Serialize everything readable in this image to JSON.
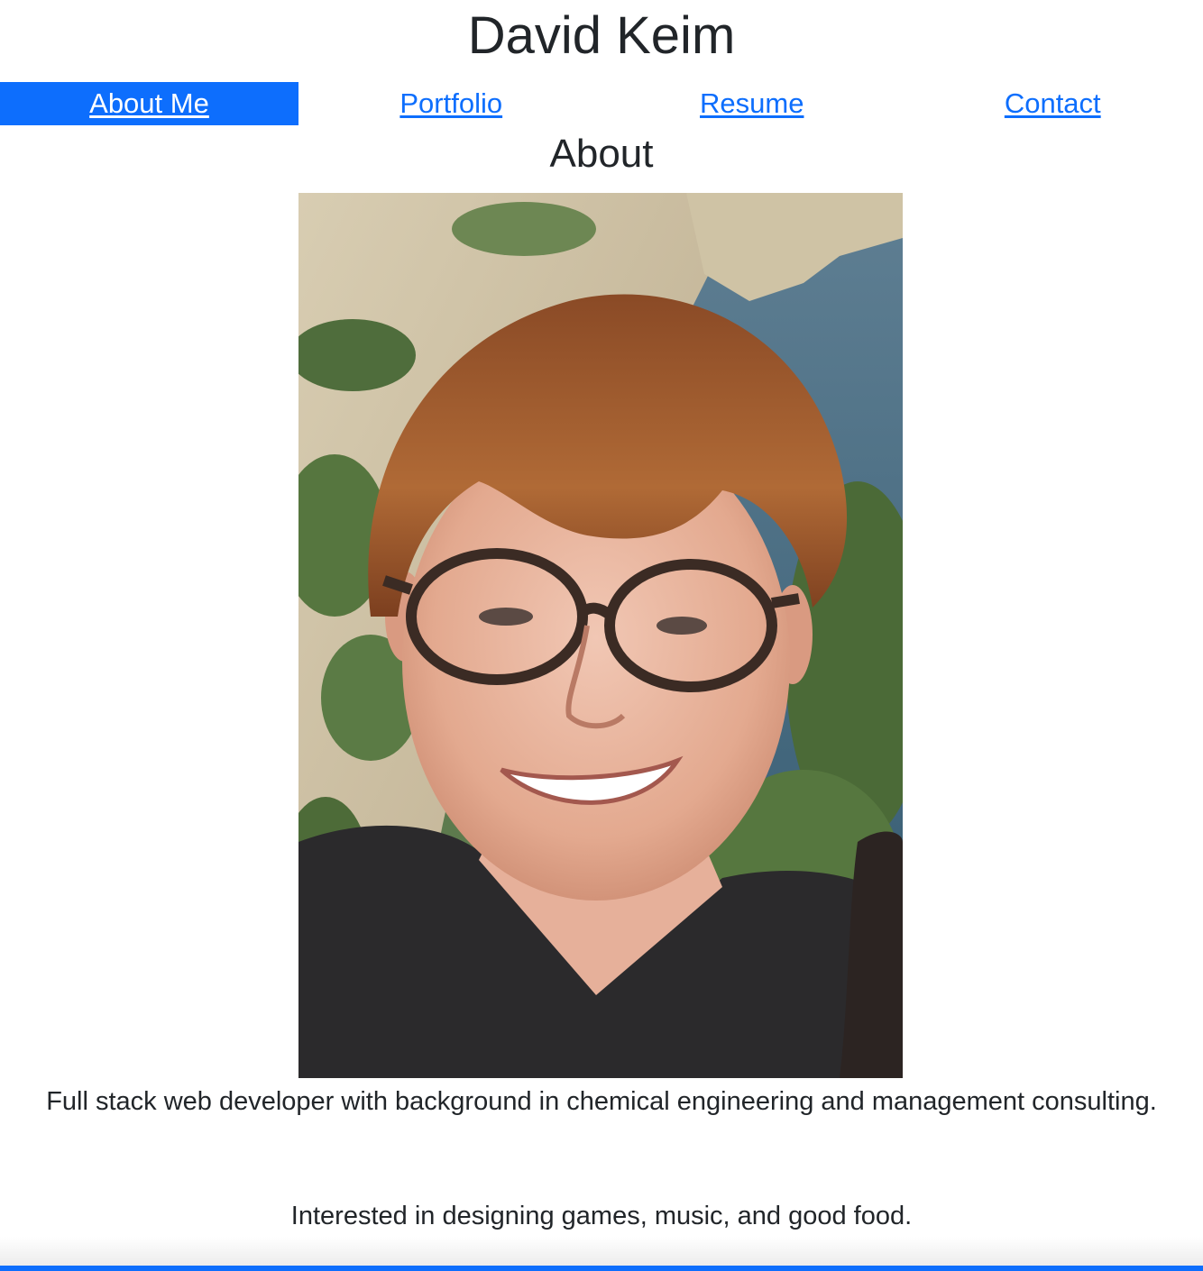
{
  "header": {
    "title": "David Keim"
  },
  "nav": {
    "items": [
      {
        "label": "About Me",
        "active": true
      },
      {
        "label": "Portfolio",
        "active": false
      },
      {
        "label": "Resume",
        "active": false
      },
      {
        "label": "Contact",
        "active": false
      }
    ]
  },
  "about": {
    "heading": "About",
    "photo_alt": "Portrait photo",
    "bio": "Full stack web developer with background in chemical engineering and management consulting.",
    "interests": "Interested in designing games, music, and good food."
  },
  "colors": {
    "accent": "#0d6efd",
    "text": "#212529",
    "background": "#ffffff"
  }
}
